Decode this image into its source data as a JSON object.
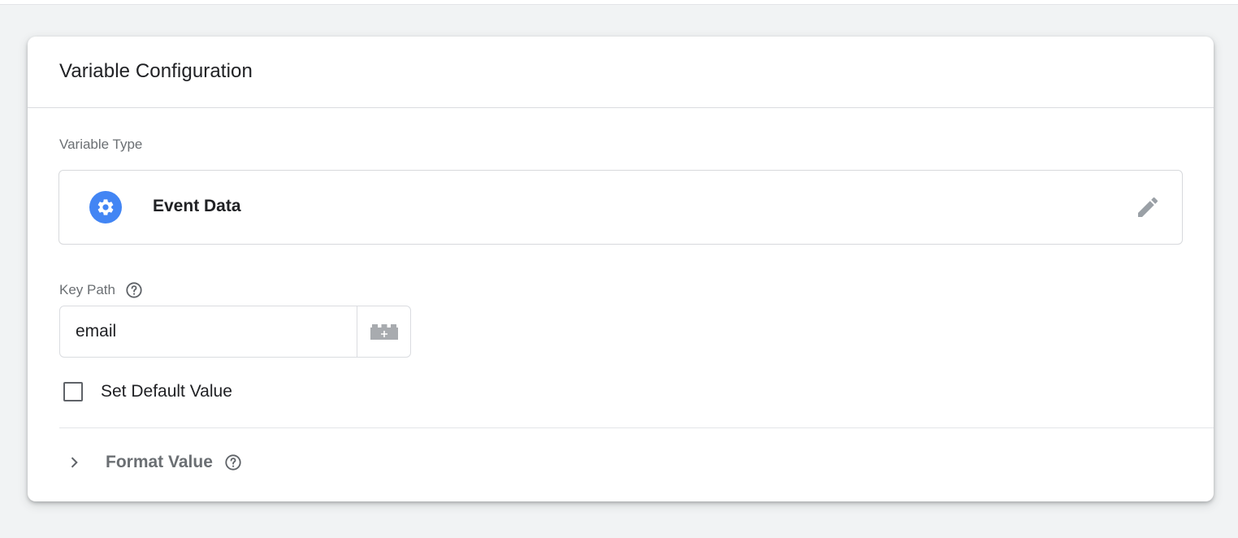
{
  "card": {
    "title": "Variable Configuration"
  },
  "variable_type": {
    "label": "Variable Type",
    "selected": "Event Data",
    "icon": "gear-icon",
    "accent_color": "#4285f4"
  },
  "key_path": {
    "label": "Key Path",
    "value": "email"
  },
  "default_value": {
    "label": "Set Default Value",
    "checked": false
  },
  "format_value": {
    "label": "Format Value",
    "expanded": false
  }
}
